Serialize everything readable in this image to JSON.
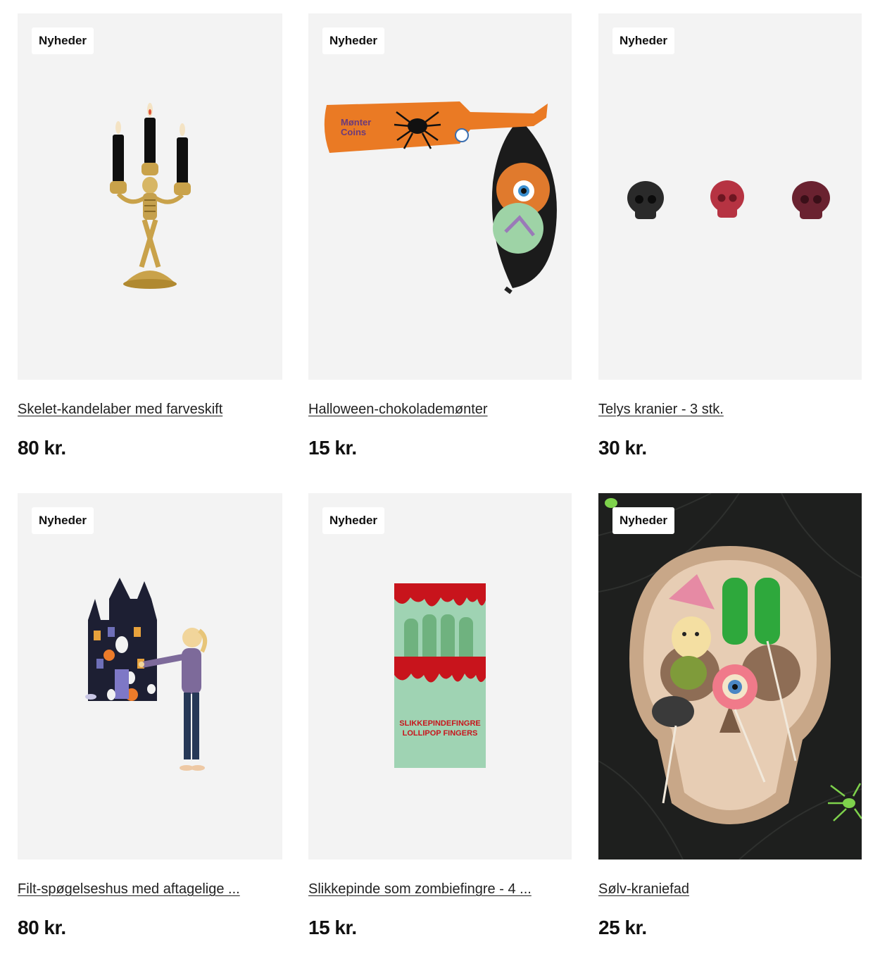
{
  "products": [
    {
      "badge": "Nyheder",
      "title": "Skelet-kandelaber med farveskift",
      "price": "80 kr.",
      "image": "skeleton-candelabra"
    },
    {
      "badge": "Nyheder",
      "title": "Halloween-chokolademønter",
      "price": "15 kr.",
      "image": "chocolate-coins-bag",
      "package_text": [
        "Mønter",
        "Coins"
      ]
    },
    {
      "badge": "Nyheder",
      "title": "Telys kranier - 3 stk.",
      "price": "30 kr.",
      "image": "skull-tealights"
    },
    {
      "badge": "Nyheder",
      "title": "Filt-spøgelseshus med aftagelige ...",
      "price": "80 kr.",
      "image": "felt-ghost-house"
    },
    {
      "badge": "Nyheder",
      "title": "Slikkepinde som zombiefingre - 4 ...",
      "price": "15 kr.",
      "image": "zombie-finger-lollipops",
      "package_text": [
        "SLIKKEPINDEFINGRE",
        "LOLLIPOP FINGERS"
      ]
    },
    {
      "badge": "Nyheder",
      "title": "Sølv-kraniefad",
      "price": "25 kr.",
      "image": "silver-skull-platter"
    }
  ]
}
